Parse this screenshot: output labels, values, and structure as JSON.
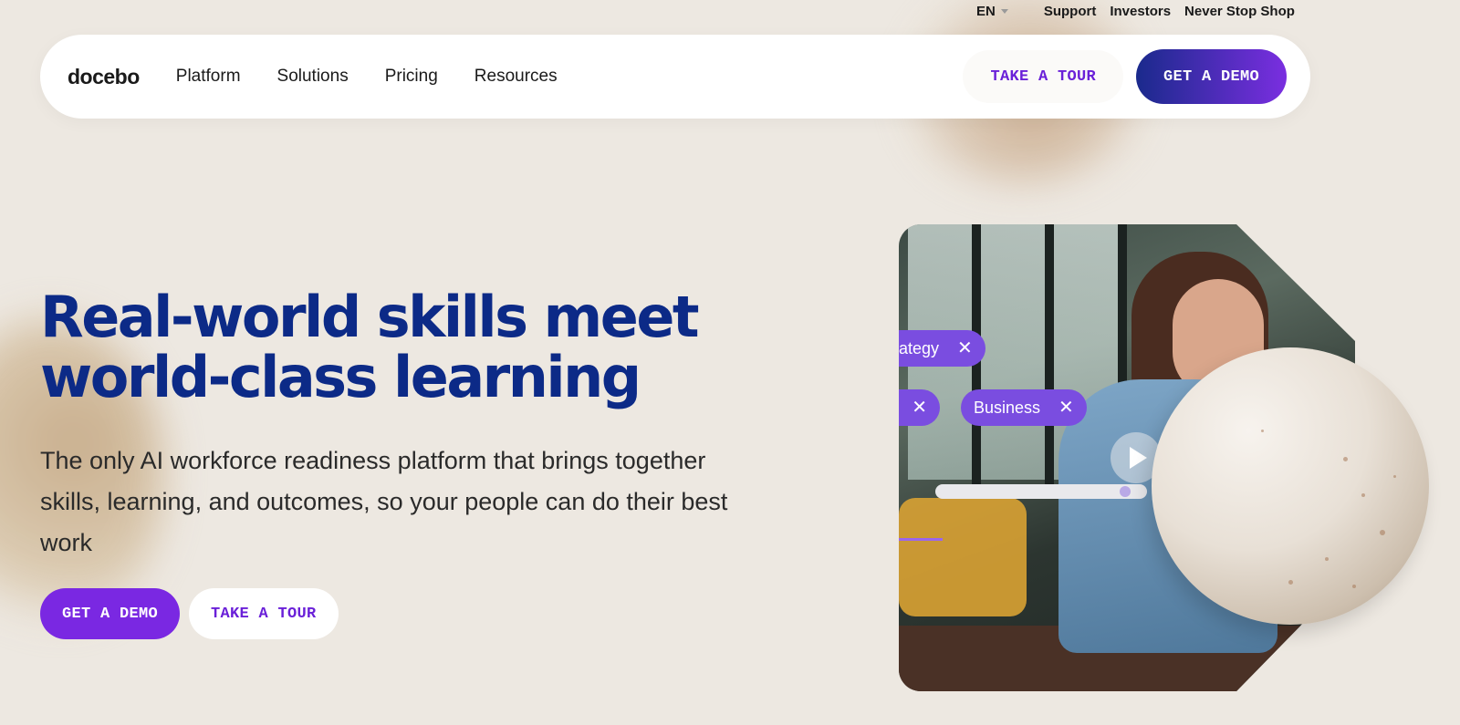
{
  "utility": {
    "lang": "EN",
    "links": [
      "Support",
      "Investors",
      "Never Stop Shop"
    ]
  },
  "nav": {
    "logo": "docebo",
    "links": [
      "Platform",
      "Solutions",
      "Pricing",
      "Resources"
    ],
    "tour_label": "TAKE A TOUR",
    "demo_label": "GET A DEMO"
  },
  "hero": {
    "title_line1": "Real-world skills meet",
    "title_line2": "world-class learning",
    "subtitle": "The only AI workforce readiness platform that brings together skills, learning, and outcomes, so your people can do their best work",
    "demo_label": "GET A DEMO",
    "tour_label": "TAKE A TOUR"
  },
  "media": {
    "chip1": "ategy",
    "chip3": "Business",
    "chip_close": "✕"
  },
  "colors": {
    "brand_navy": "#0c2a87",
    "brand_purple": "#7a28e2",
    "background": "#ede8e1"
  }
}
